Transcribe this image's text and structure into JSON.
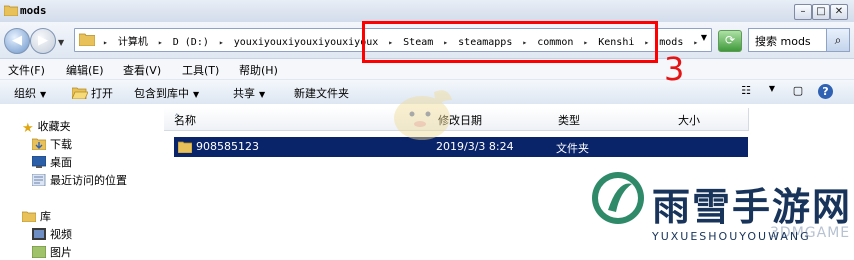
{
  "window": {
    "title": "mods"
  },
  "address": {
    "crumbs": [
      "计算机",
      "D (D:)",
      "youxiyouxiyouxiyouxiyoux",
      "Steam",
      "steamapps",
      "common",
      "Kenshi",
      "mods"
    ]
  },
  "search": {
    "placeholder": "搜索 mods"
  },
  "menu": [
    "文件(F)",
    "编辑(E)",
    "查看(V)",
    "工具(T)",
    "帮助(H)"
  ],
  "toolbar": {
    "organize": "组织",
    "open": "打开",
    "include_library": "包含到库中",
    "share": "共享",
    "new_folder": "新建文件夹"
  },
  "sidebar": {
    "favorites": "收藏夹",
    "downloads": "下载",
    "desktop": "桌面",
    "recent": "最近访问的位置",
    "libraries": "库",
    "videos": "视频",
    "pictures": "图片"
  },
  "columns": {
    "name": "名称",
    "modified": "修改日期",
    "type": "类型",
    "size": "大小"
  },
  "files": [
    {
      "name": "908585123",
      "modified": "2019/3/3 8:24",
      "type": "文件夹"
    }
  ],
  "annotation": {
    "step": "3",
    "color": "#e51313"
  },
  "watermark": {
    "title": "雨雪手游网",
    "subtitle": "YUXUESHOUYOUWANG",
    "brand": "3DMGAME"
  },
  "colors": {
    "selection": "#0a246a",
    "annotation_box": "#ff0000"
  }
}
